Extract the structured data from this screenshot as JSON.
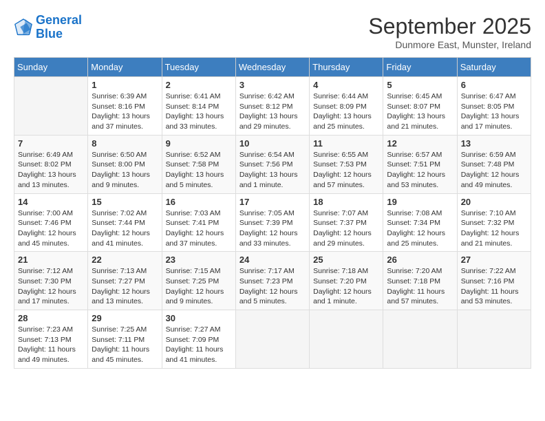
{
  "header": {
    "logo_line1": "General",
    "logo_line2": "Blue",
    "month_title": "September 2025",
    "subtitle": "Dunmore East, Munster, Ireland"
  },
  "weekdays": [
    "Sunday",
    "Monday",
    "Tuesday",
    "Wednesday",
    "Thursday",
    "Friday",
    "Saturday"
  ],
  "weeks": [
    [
      {
        "num": "",
        "detail": ""
      },
      {
        "num": "1",
        "detail": "Sunrise: 6:39 AM\nSunset: 8:16 PM\nDaylight: 13 hours\nand 37 minutes."
      },
      {
        "num": "2",
        "detail": "Sunrise: 6:41 AM\nSunset: 8:14 PM\nDaylight: 13 hours\nand 33 minutes."
      },
      {
        "num": "3",
        "detail": "Sunrise: 6:42 AM\nSunset: 8:12 PM\nDaylight: 13 hours\nand 29 minutes."
      },
      {
        "num": "4",
        "detail": "Sunrise: 6:44 AM\nSunset: 8:09 PM\nDaylight: 13 hours\nand 25 minutes."
      },
      {
        "num": "5",
        "detail": "Sunrise: 6:45 AM\nSunset: 8:07 PM\nDaylight: 13 hours\nand 21 minutes."
      },
      {
        "num": "6",
        "detail": "Sunrise: 6:47 AM\nSunset: 8:05 PM\nDaylight: 13 hours\nand 17 minutes."
      }
    ],
    [
      {
        "num": "7",
        "detail": "Sunrise: 6:49 AM\nSunset: 8:02 PM\nDaylight: 13 hours\nand 13 minutes."
      },
      {
        "num": "8",
        "detail": "Sunrise: 6:50 AM\nSunset: 8:00 PM\nDaylight: 13 hours\nand 9 minutes."
      },
      {
        "num": "9",
        "detail": "Sunrise: 6:52 AM\nSunset: 7:58 PM\nDaylight: 13 hours\nand 5 minutes."
      },
      {
        "num": "10",
        "detail": "Sunrise: 6:54 AM\nSunset: 7:56 PM\nDaylight: 13 hours\nand 1 minute."
      },
      {
        "num": "11",
        "detail": "Sunrise: 6:55 AM\nSunset: 7:53 PM\nDaylight: 12 hours\nand 57 minutes."
      },
      {
        "num": "12",
        "detail": "Sunrise: 6:57 AM\nSunset: 7:51 PM\nDaylight: 12 hours\nand 53 minutes."
      },
      {
        "num": "13",
        "detail": "Sunrise: 6:59 AM\nSunset: 7:48 PM\nDaylight: 12 hours\nand 49 minutes."
      }
    ],
    [
      {
        "num": "14",
        "detail": "Sunrise: 7:00 AM\nSunset: 7:46 PM\nDaylight: 12 hours\nand 45 minutes."
      },
      {
        "num": "15",
        "detail": "Sunrise: 7:02 AM\nSunset: 7:44 PM\nDaylight: 12 hours\nand 41 minutes."
      },
      {
        "num": "16",
        "detail": "Sunrise: 7:03 AM\nSunset: 7:41 PM\nDaylight: 12 hours\nand 37 minutes."
      },
      {
        "num": "17",
        "detail": "Sunrise: 7:05 AM\nSunset: 7:39 PM\nDaylight: 12 hours\nand 33 minutes."
      },
      {
        "num": "18",
        "detail": "Sunrise: 7:07 AM\nSunset: 7:37 PM\nDaylight: 12 hours\nand 29 minutes."
      },
      {
        "num": "19",
        "detail": "Sunrise: 7:08 AM\nSunset: 7:34 PM\nDaylight: 12 hours\nand 25 minutes."
      },
      {
        "num": "20",
        "detail": "Sunrise: 7:10 AM\nSunset: 7:32 PM\nDaylight: 12 hours\nand 21 minutes."
      }
    ],
    [
      {
        "num": "21",
        "detail": "Sunrise: 7:12 AM\nSunset: 7:30 PM\nDaylight: 12 hours\nand 17 minutes."
      },
      {
        "num": "22",
        "detail": "Sunrise: 7:13 AM\nSunset: 7:27 PM\nDaylight: 12 hours\nand 13 minutes."
      },
      {
        "num": "23",
        "detail": "Sunrise: 7:15 AM\nSunset: 7:25 PM\nDaylight: 12 hours\nand 9 minutes."
      },
      {
        "num": "24",
        "detail": "Sunrise: 7:17 AM\nSunset: 7:23 PM\nDaylight: 12 hours\nand 5 minutes."
      },
      {
        "num": "25",
        "detail": "Sunrise: 7:18 AM\nSunset: 7:20 PM\nDaylight: 12 hours\nand 1 minute."
      },
      {
        "num": "26",
        "detail": "Sunrise: 7:20 AM\nSunset: 7:18 PM\nDaylight: 11 hours\nand 57 minutes."
      },
      {
        "num": "27",
        "detail": "Sunrise: 7:22 AM\nSunset: 7:16 PM\nDaylight: 11 hours\nand 53 minutes."
      }
    ],
    [
      {
        "num": "28",
        "detail": "Sunrise: 7:23 AM\nSunset: 7:13 PM\nDaylight: 11 hours\nand 49 minutes."
      },
      {
        "num": "29",
        "detail": "Sunrise: 7:25 AM\nSunset: 7:11 PM\nDaylight: 11 hours\nand 45 minutes."
      },
      {
        "num": "30",
        "detail": "Sunrise: 7:27 AM\nSunset: 7:09 PM\nDaylight: 11 hours\nand 41 minutes."
      },
      {
        "num": "",
        "detail": ""
      },
      {
        "num": "",
        "detail": ""
      },
      {
        "num": "",
        "detail": ""
      },
      {
        "num": "",
        "detail": ""
      }
    ]
  ]
}
